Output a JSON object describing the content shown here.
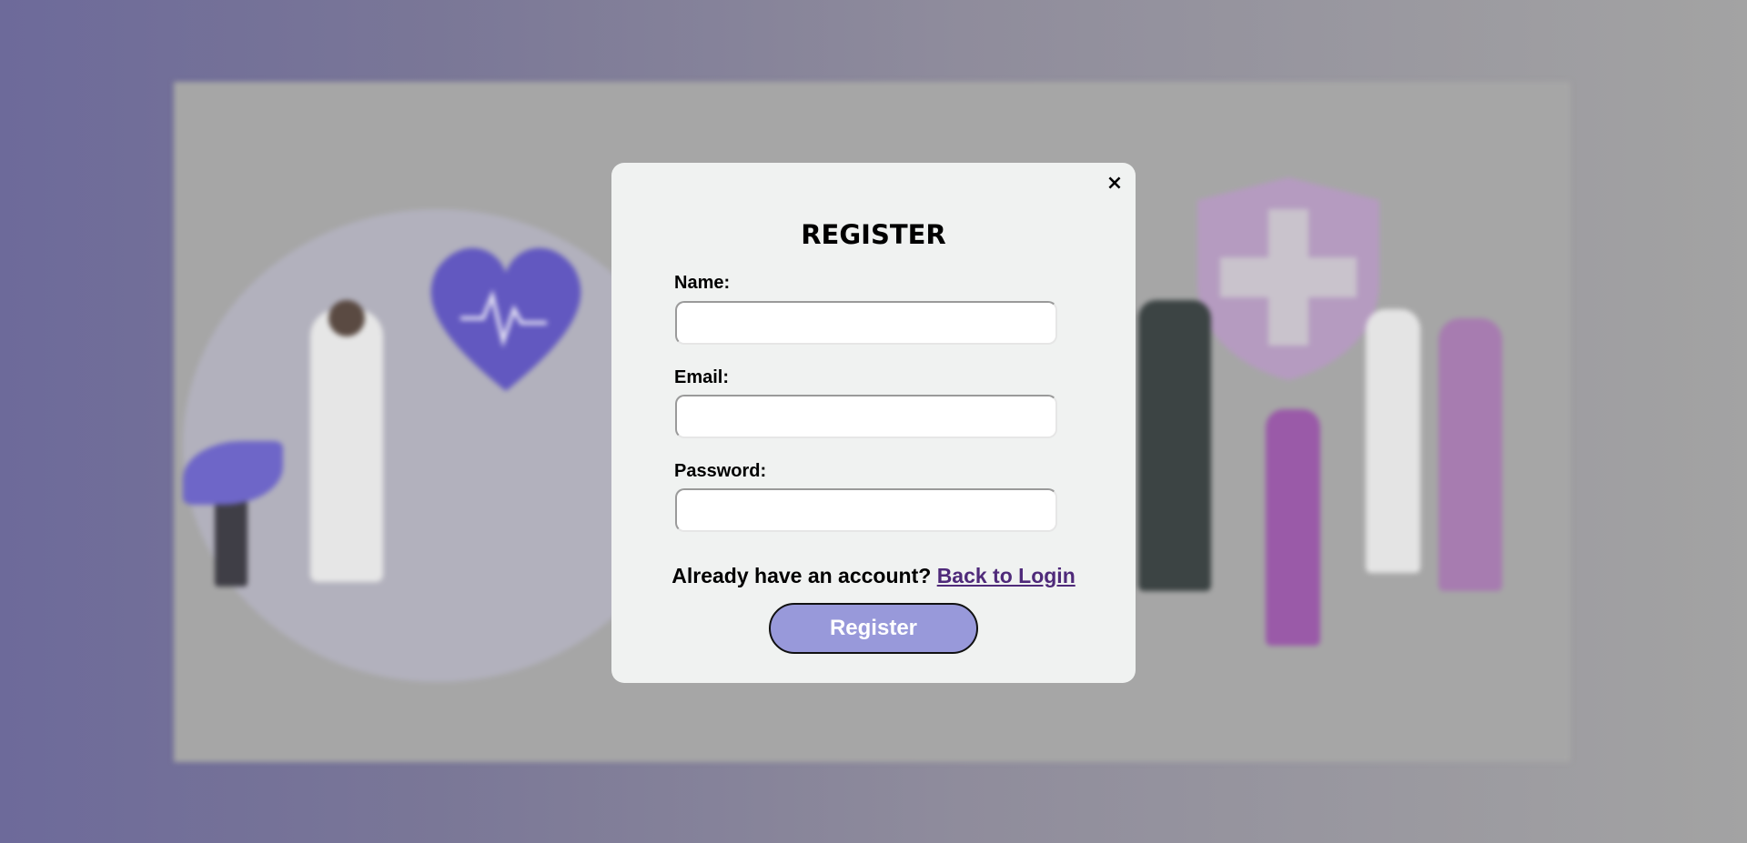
{
  "modal": {
    "close_label": "×",
    "title": "REGISTER",
    "fields": {
      "name": {
        "label": "Name:",
        "value": "",
        "placeholder": ""
      },
      "email": {
        "label": "Email:",
        "value": "",
        "placeholder": ""
      },
      "password": {
        "label": "Password:",
        "value": "",
        "placeholder": ""
      }
    },
    "account_prompt": "Already have an account?",
    "login_link": "Back to Login",
    "register_button": "Register"
  },
  "colors": {
    "modal_background": "#f0f2f1",
    "register_button": "#9899da",
    "link": "#4f2a7a",
    "accent_purple": "#6b62c4"
  },
  "background": {
    "illustration_icons": [
      "heart-pulse-icon",
      "medical-cross-shield-icon",
      "doctor-figure",
      "patients-group-figure",
      "plant-figure"
    ]
  }
}
